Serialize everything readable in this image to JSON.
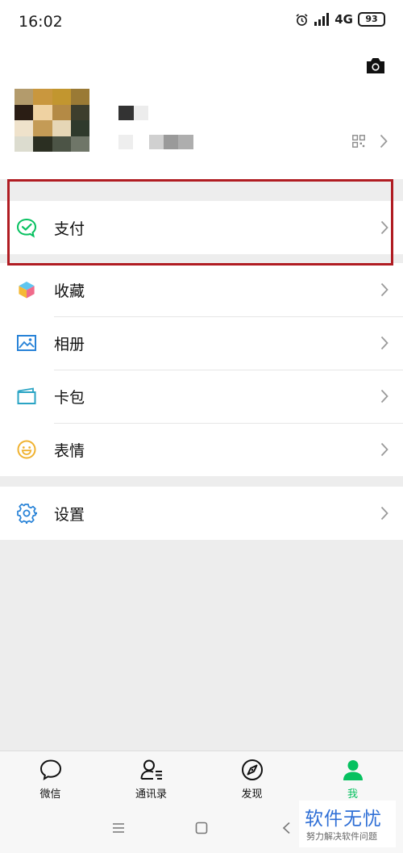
{
  "status_bar": {
    "time": "16:02",
    "network": "4G",
    "battery": "93"
  },
  "profile": {
    "camera_icon": "camera-icon",
    "qr_icon": "qr-code-icon"
  },
  "menu": {
    "pay_group": [
      {
        "label": "支付",
        "icon": "pay-icon",
        "color": "#07c160"
      }
    ],
    "main_group": [
      {
        "label": "收藏",
        "icon": "favorites-cube-icon"
      },
      {
        "label": "相册",
        "icon": "album-icon",
        "color": "#2782d7"
      },
      {
        "label": "卡包",
        "icon": "card-wallet-icon",
        "color": "#2aa4c4"
      },
      {
        "label": "表情",
        "icon": "sticker-smile-icon",
        "color": "#f0b230"
      }
    ],
    "settings_group": [
      {
        "label": "设置",
        "icon": "settings-gear-icon",
        "color": "#2782d7"
      }
    ]
  },
  "highlight_color": "#b01c22",
  "tabbar": {
    "tabs": [
      {
        "label": "微信",
        "icon": "chat-bubble-icon",
        "active": false
      },
      {
        "label": "通讯录",
        "icon": "contacts-icon",
        "active": false
      },
      {
        "label": "发现",
        "icon": "compass-icon",
        "active": false
      },
      {
        "label": "我",
        "icon": "me-person-icon",
        "active": true
      }
    ],
    "active_color": "#07c160"
  },
  "navbar": {
    "icons": [
      "menu-icon",
      "home-square-icon",
      "back-icon"
    ]
  },
  "watermark": {
    "title": "软件无忧",
    "subtitle": "努力解决软件问题"
  }
}
